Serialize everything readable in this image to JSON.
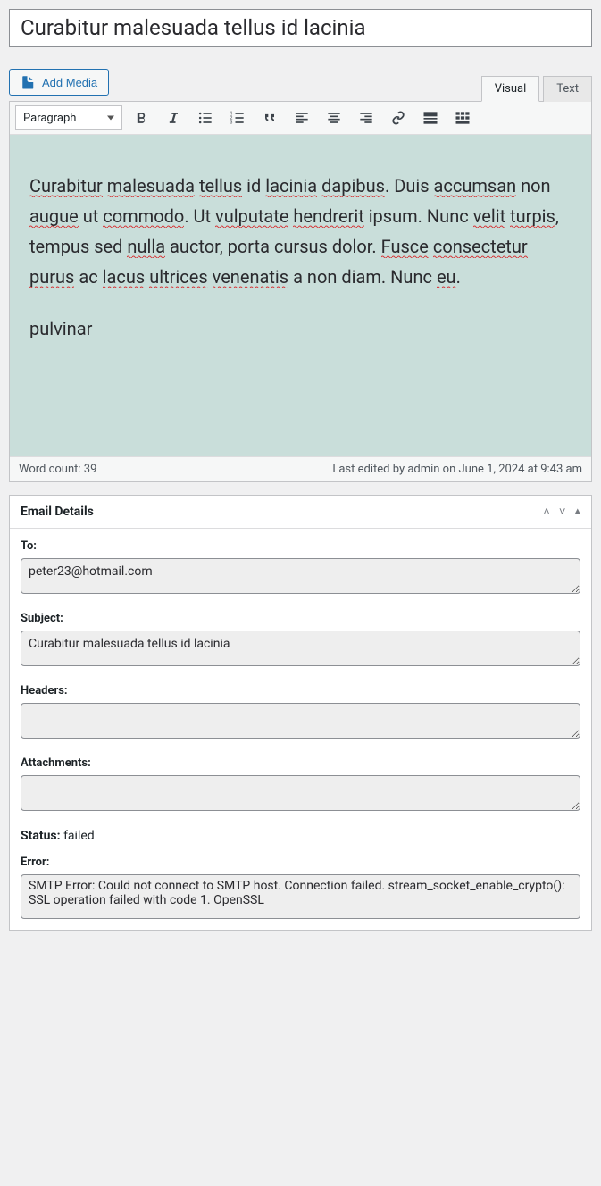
{
  "title": "Curabitur malesuada tellus id lacinia",
  "addMediaLabel": "Add Media",
  "tabs": {
    "visual": "Visual",
    "text": "Text"
  },
  "toolbar": {
    "format": "Paragraph"
  },
  "content": {
    "p1_words": [
      "Curabitur",
      "malesuada",
      "tellus",
      "id",
      "lacinia",
      "dapibus",
      ".",
      "Duis",
      "accumsan",
      "non",
      "augue",
      "ut",
      "commodo",
      ".",
      "Ut",
      "vulputate",
      "hendrerit",
      "ipsum",
      ".",
      "Nunc",
      "velit",
      "turpis",
      ",",
      "tempus",
      "sed",
      "nulla",
      "auctor",
      ",",
      "porta",
      "cursus",
      "dolor",
      ".",
      "Fusce",
      "consectetur",
      "purus",
      "ac",
      "lacus",
      "ultrices",
      "venenatis",
      "a",
      "non",
      "diam",
      ".",
      "Nunc",
      "eu",
      "."
    ],
    "p1_spell": [
      true,
      true,
      true,
      false,
      true,
      true,
      false,
      false,
      true,
      false,
      true,
      false,
      true,
      false,
      false,
      true,
      true,
      false,
      false,
      false,
      true,
      true,
      false,
      false,
      false,
      true,
      false,
      false,
      false,
      false,
      false,
      false,
      true,
      true,
      true,
      false,
      true,
      true,
      true,
      false,
      false,
      false,
      false,
      false,
      true,
      false
    ],
    "p2": "pulvinar"
  },
  "footer": {
    "wordcount_label": "Word count:",
    "wordcount": "39",
    "lastedit": "Last edited by admin on June 1, 2024 at 9:43 am"
  },
  "panel": {
    "title": "Email Details",
    "fields": {
      "to_label": "To:",
      "to_value": "peter23@hotmail.com",
      "subject_label": "Subject:",
      "subject_value": "Curabitur malesuada tellus id lacinia",
      "headers_label": "Headers:",
      "headers_value": "",
      "attachments_label": "Attachments:",
      "attachments_value": "",
      "status_label": "Status:",
      "status_value": "failed",
      "error_label": "Error:",
      "error_value": "SMTP Error: Could not connect to SMTP host. Connection failed. stream_socket_enable_crypto(): SSL operation failed with code 1. OpenSSL"
    }
  }
}
